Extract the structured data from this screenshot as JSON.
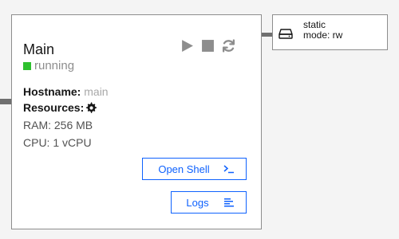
{
  "node": {
    "title": "Main",
    "status": "running",
    "hostname_label": "Hostname:",
    "hostname_value": "main",
    "resources_label": "Resources:",
    "ram": "RAM: 256 MB",
    "cpu": "CPU: 1 vCPU",
    "open_shell_label": "Open Shell",
    "logs_label": "Logs"
  },
  "storage": {
    "name": "static",
    "mode": "mode: rw"
  },
  "icons": {
    "play": "play-icon",
    "stop": "stop-icon",
    "restart": "restart-icon",
    "settings": "gear-icon",
    "terminal": "terminal-icon",
    "logs": "logs-icon",
    "disk": "hard-drive-icon"
  },
  "colors": {
    "running": "#2ec02e",
    "accent": "#0f62fe",
    "border": "#8d8d8d",
    "muted": "#a8a8a8"
  }
}
